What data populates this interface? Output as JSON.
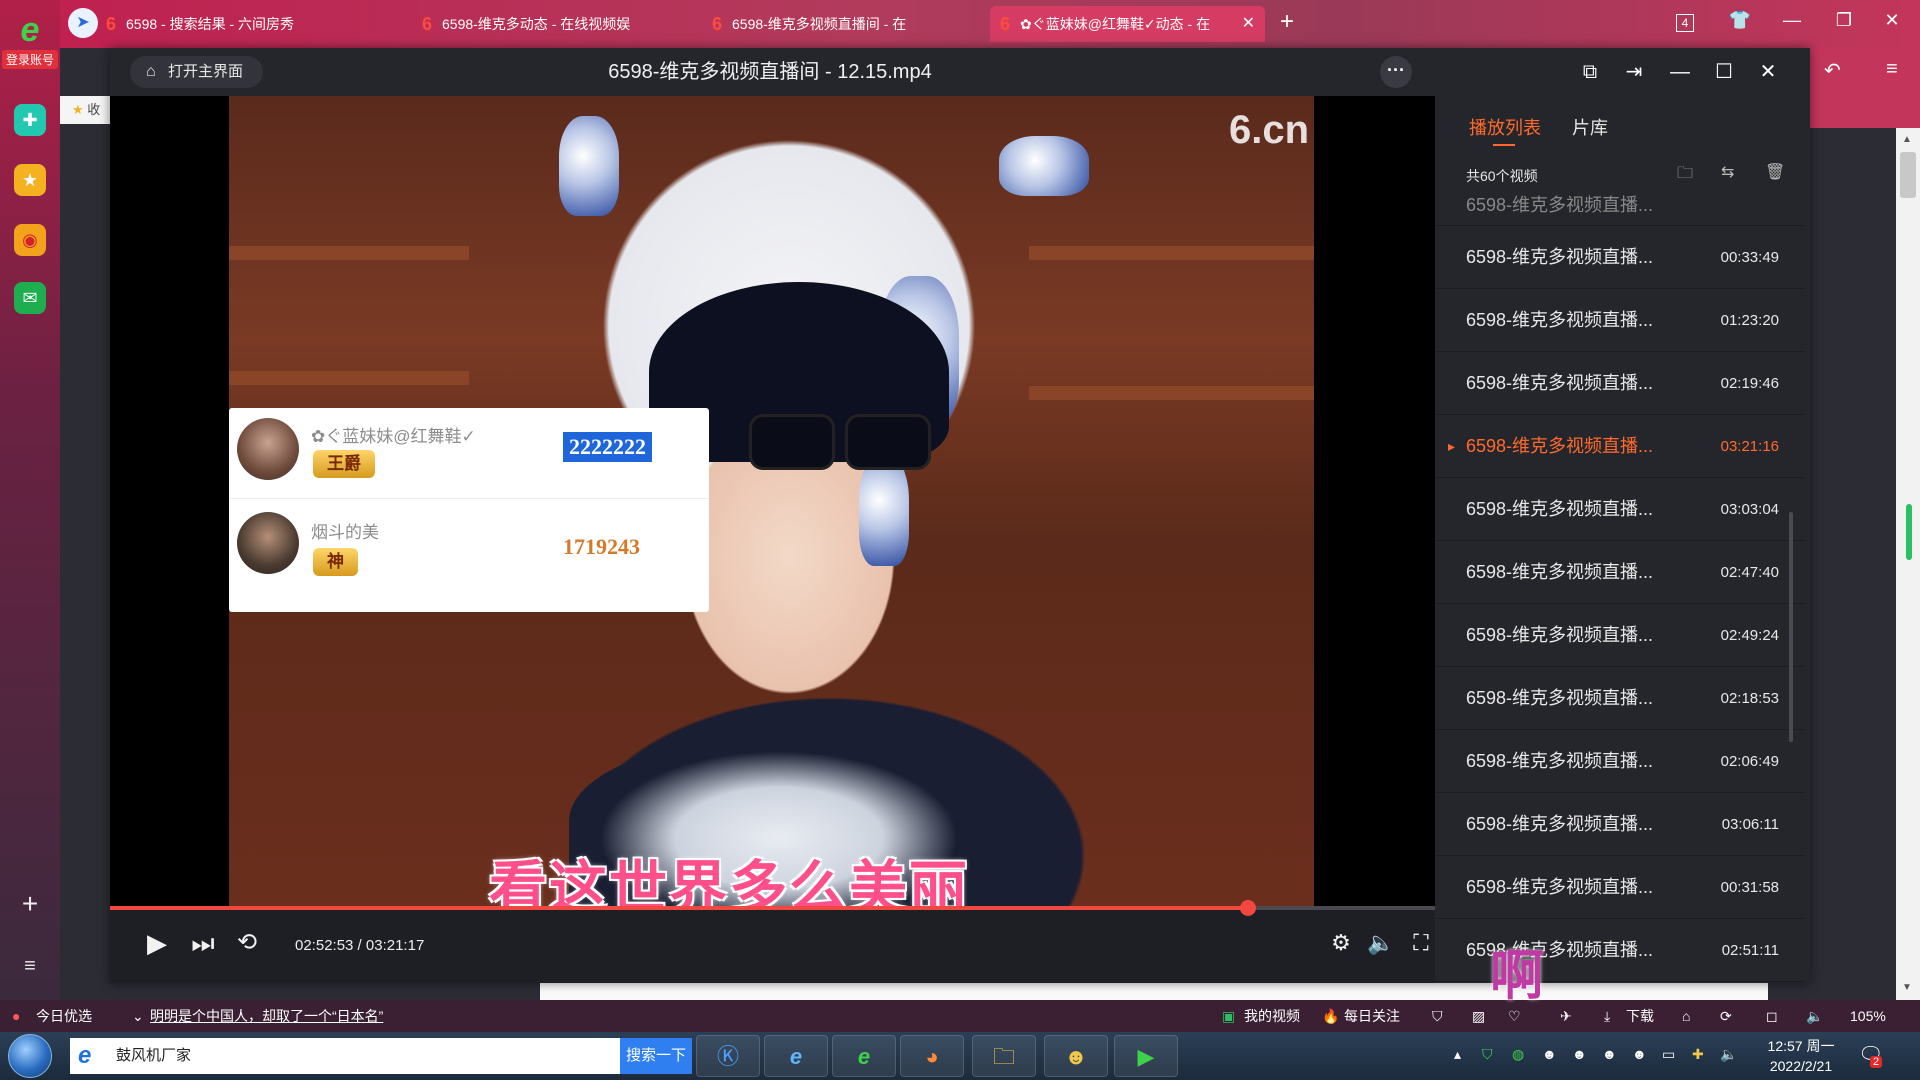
{
  "browser": {
    "account_label": "登录账号",
    "tabs": [
      {
        "label": "6598 - 搜索结果 - 六间房秀",
        "active": false
      },
      {
        "label": "6598-维克多动态 - 在线视频娱",
        "active": false
      },
      {
        "label": "6598-维克多视频直播间 - 在",
        "active": false
      },
      {
        "label": "✿ぐ蓝妹妹@红舞鞋✓动态 - 在",
        "active": true
      }
    ],
    "tab_count": "4",
    "bookmark_label": "收"
  },
  "player": {
    "open_main_label": "打开主界面",
    "title": "6598-维克多视频直播间 - 12.15.mp4",
    "watermark": "6.cn",
    "gift_board": [
      {
        "name": "✿ぐ蓝妹妹@红舞鞋✓",
        "badge": "王爵",
        "score": "2222222"
      },
      {
        "name": "烟斗的美",
        "badge": "神",
        "score": "1719243"
      }
    ],
    "subtitle": "看这世界多么美丽",
    "current_time": "02:52:53",
    "total_time": "03:21:17",
    "progress": 0.8589,
    "time_display": "02:52:53 / 03:21:17"
  },
  "playlist": {
    "tab_playlist": "播放列表",
    "tab_library": "片库",
    "count_label": "共60个视频",
    "items": [
      {
        "title": "6598-维克多视频直播...",
        "duration": "00:33:49",
        "active": false
      },
      {
        "title": "6598-维克多视频直播...",
        "duration": "01:23:20",
        "active": false
      },
      {
        "title": "6598-维克多视频直播...",
        "duration": "02:19:46",
        "active": false
      },
      {
        "title": "6598-维克多视频直播...",
        "duration": "03:21:16",
        "active": true
      },
      {
        "title": "6598-维克多视频直播...",
        "duration": "03:03:04",
        "active": false
      },
      {
        "title": "6598-维克多视频直播...",
        "duration": "02:47:40",
        "active": false
      },
      {
        "title": "6598-维克多视频直播...",
        "duration": "02:49:24",
        "active": false
      },
      {
        "title": "6598-维克多视频直播...",
        "duration": "02:18:53",
        "active": false
      },
      {
        "title": "6598-维克多视频直播...",
        "duration": "02:06:49",
        "active": false
      },
      {
        "title": "6598-维克多视频直播...",
        "duration": "03:06:11",
        "active": false
      },
      {
        "title": "6598-维克多视频直播...",
        "duration": "00:31:58",
        "active": false
      },
      {
        "title": "6598-维克多视频直播...",
        "duration": "02:51:11",
        "active": false
      }
    ]
  },
  "status_bar": {
    "today_pick": "今日优选",
    "headline": "明明是个中国人，却取了一个“日本名”",
    "my_video": "我的视频",
    "daily_follow": "每日关注",
    "download": "下载",
    "zoom": "105%",
    "overlay_text": "啊"
  },
  "taskbar": {
    "search_value": "鼓风机厂家",
    "search_button": "搜索一下",
    "time": "12:57 周一",
    "date": "2022/2/21",
    "notify_count": "2"
  },
  "colors": {
    "accent": "#ff6a2c",
    "progress": "#f0483e",
    "browser": "#c11f4f"
  }
}
